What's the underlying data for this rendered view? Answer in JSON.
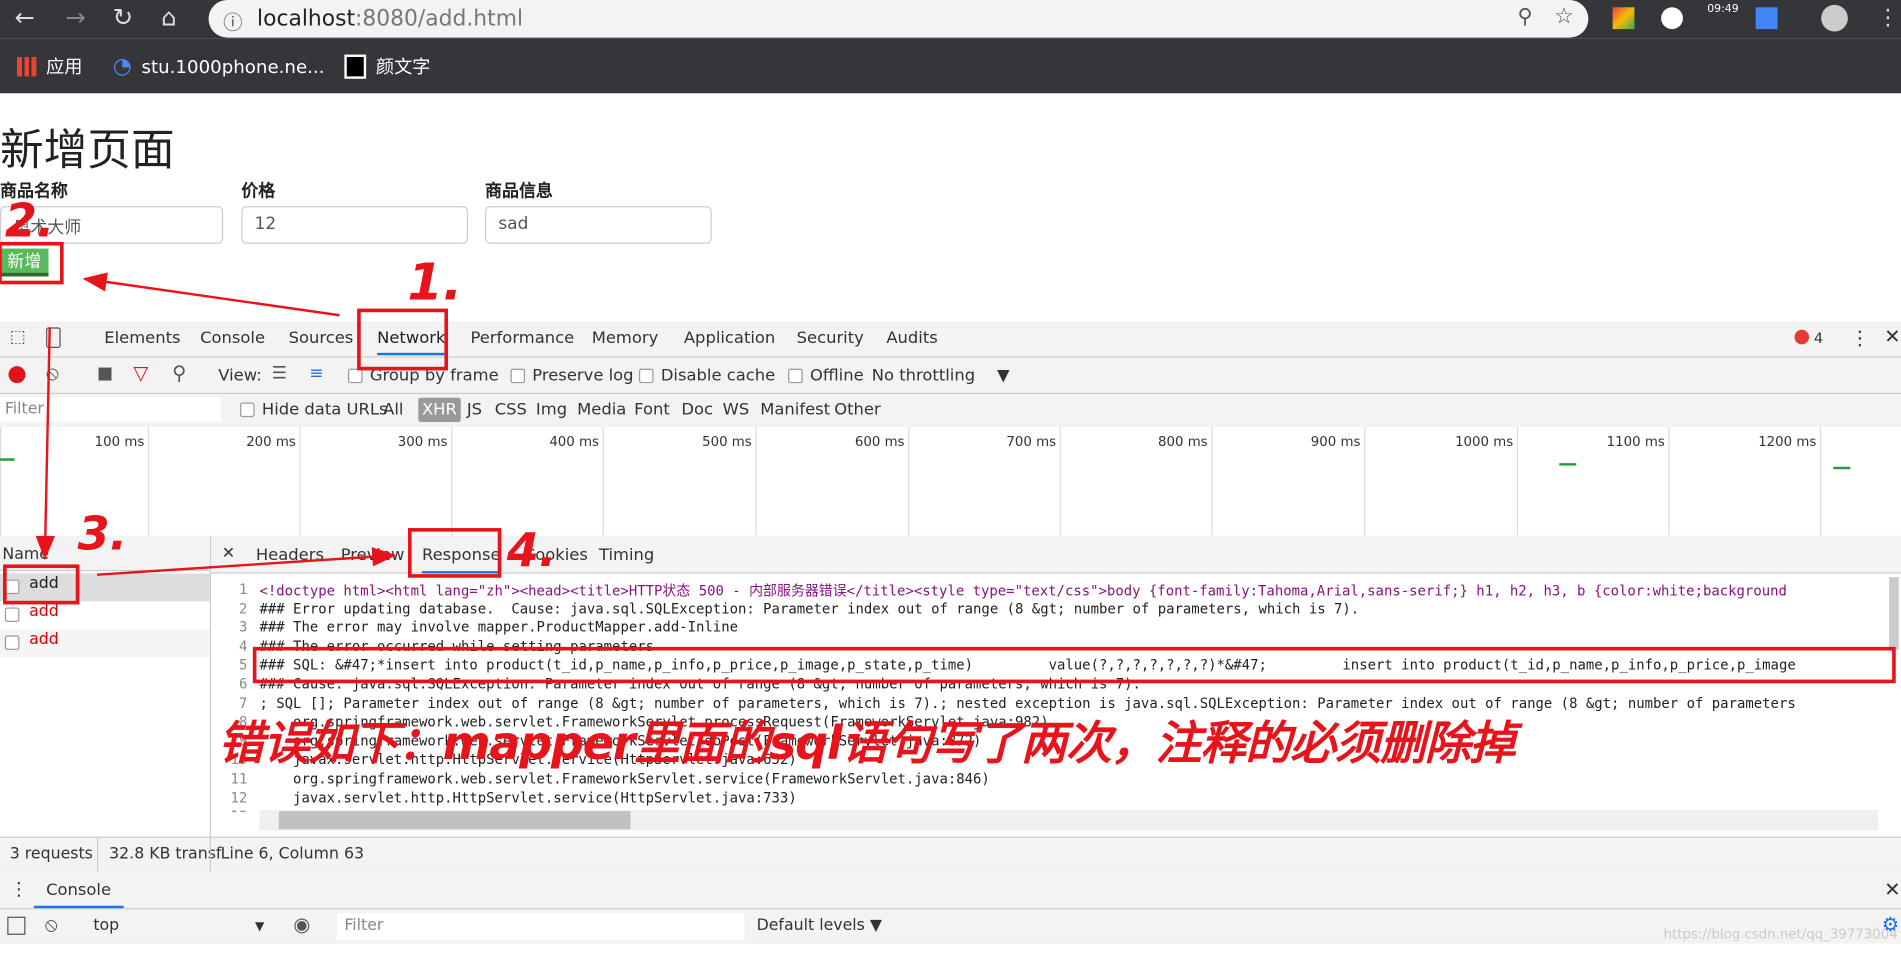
{
  "browser": {
    "url_host": "localhost",
    "url_rest": ":8080/add.html",
    "clock": "09:49",
    "bookmarks": [
      {
        "label": "应用"
      },
      {
        "label": "stu.1000phone.ne..."
      },
      {
        "label": "颜文字"
      }
    ]
  },
  "page": {
    "title": "新增页面",
    "fields": [
      {
        "label": "商品名称",
        "value": "奥术大师"
      },
      {
        "label": "价格",
        "value": "12"
      },
      {
        "label": "商品信息",
        "value": "sad"
      }
    ],
    "submit_label": "新增"
  },
  "devtools": {
    "tabs": [
      "Elements",
      "Console",
      "Sources",
      "Network",
      "Performance",
      "Memory",
      "Application",
      "Security",
      "Audits"
    ],
    "active_tab": "Network",
    "error_count": "4",
    "toolbar": {
      "view": "View:",
      "group": "Group by frame",
      "preserve": "Preserve log",
      "disable_cache": "Disable cache",
      "offline": "Offline",
      "throttle": "No throttling"
    },
    "filter": {
      "placeholder": "Filter",
      "hide_data": "Hide data URLs",
      "types": [
        "All",
        "XHR",
        "JS",
        "CSS",
        "Img",
        "Media",
        "Font",
        "Doc",
        "WS",
        "Manifest",
        "Other"
      ],
      "active_type": "XHR"
    },
    "timeline_ticks": [
      "100 ms",
      "200 ms",
      "300 ms",
      "400 ms",
      "500 ms",
      "600 ms",
      "700 ms",
      "800 ms",
      "900 ms",
      "1000 ms",
      "1100 ms",
      "1200 ms"
    ],
    "name_header": "Name",
    "requests": [
      "add",
      "add",
      "add"
    ],
    "detail_tabs": [
      "Headers",
      "Preview",
      "Response",
      "Cookies",
      "Timing"
    ],
    "active_detail_tab": "Response",
    "code_lines": [
      "<!doctype html><html lang=\"zh\"><head><title>HTTP状态 500 - 内部服务器错误</title><style type=\"text/css\">body {font-family:Tahoma,Arial,sans-serif;} h1, h2, h3, b {color:white;background",
      "### Error updating database.  Cause: java.sql.SQLException: Parameter index out of range (8 &gt; number of parameters, which is 7).",
      "### The error may involve mapper.ProductMapper.add-Inline",
      "### The error occurred while setting parameters",
      "### SQL: &#47;*insert into product(t_id,p_name,p_info,p_price,p_image,p_state,p_time)         value(?,?,?,?,?,?,?)*&#47;         insert into product(t_id,p_name,p_info,p_price,p_image",
      "### Cause: java.sql.SQLException: Parameter index out of range (8 &gt; number of parameters, which is 7).",
      "; SQL []; Parameter index out of range (8 &gt; number of parameters, which is 7).; nested exception is java.sql.SQLException: Parameter index out of range (8 &gt; number of parameters",
      "    org.springframework.web.servlet.FrameworkServlet.processRequest(FrameworkServlet.java:982)",
      "    org.springframework.web.servlet.FrameworkServlet.doPost(FrameworkServlet.java:872)",
      "    javax.servlet.http.HttpServlet.service(HttpServlet.java:652)",
      "    org.springframework.web.servlet.FrameworkServlet.service(FrameworkServlet.java:846)",
      "    javax.servlet.http.HttpServlet.service(HttpServlet.java:733)",
      ""
    ],
    "status": {
      "requests": "3 requests",
      "transferred": "32.8 KB transf",
      "cursor": "Line 6, Column 63"
    },
    "drawer_tab": "Console",
    "console": {
      "context": "top",
      "filter_placeholder": "Filter",
      "levels": "Default levels"
    }
  },
  "annotations": {
    "step1": "1.",
    "step2": "2.",
    "step3": "3.",
    "step4": "4.",
    "note": "错误如下：mapper里面的sql语句写了两次，注释的必须删除掉",
    "color": "#e8141b"
  },
  "watermark": "https://blog.csdn.net/qq_39773004"
}
